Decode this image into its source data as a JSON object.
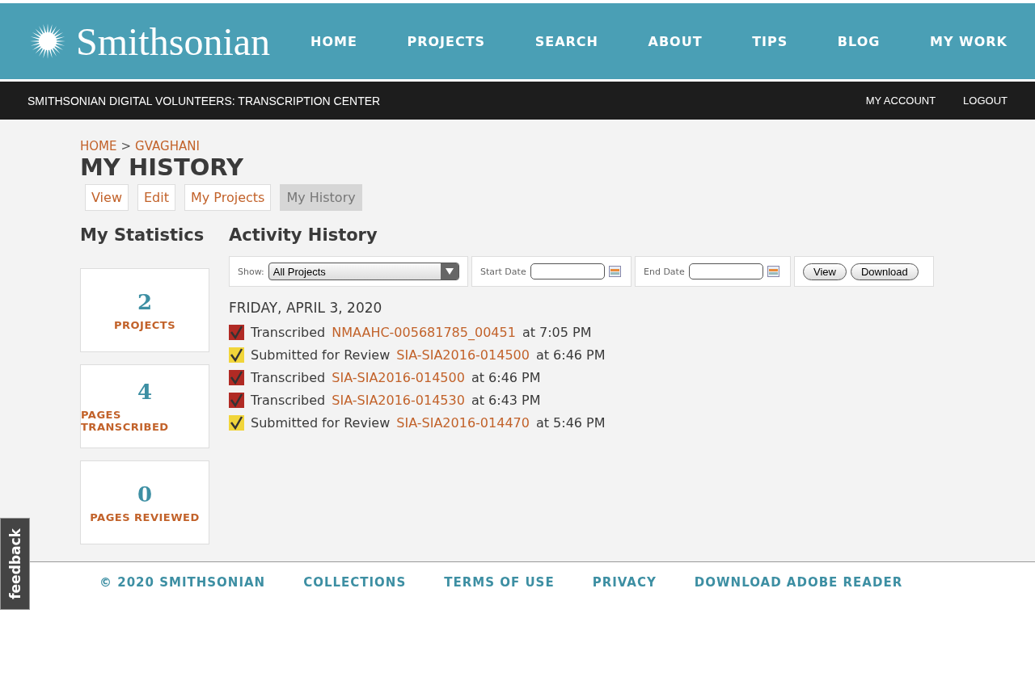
{
  "header": {
    "logo": "Smithsonian",
    "nav": [
      "HOME",
      "PROJECTS",
      "SEARCH",
      "ABOUT",
      "TIPS",
      "BLOG",
      "MY WORK"
    ]
  },
  "subheader": {
    "title": "SMITHSONIAN DIGITAL VOLUNTEERS: TRANSCRIPTION CENTER",
    "links": [
      "MY ACCOUNT",
      "LOGOUT"
    ]
  },
  "breadcrumb": [
    "HOME",
    "GVAGHANI"
  ],
  "breadcrumb_separator": ">",
  "page_title": "MY HISTORY",
  "tabs": [
    {
      "label": "View",
      "selected": false
    },
    {
      "label": "Edit",
      "selected": false
    },
    {
      "label": "My Projects",
      "selected": false
    },
    {
      "label": "My History",
      "selected": true
    }
  ],
  "statistics": {
    "title": "My Statistics",
    "cards": [
      {
        "value": "2",
        "label": "PROJECTS"
      },
      {
        "value": "4",
        "label": "PAGES TRANSCRIBED"
      },
      {
        "value": "0",
        "label": "PAGES REVIEWED"
      }
    ]
  },
  "activity": {
    "title": "Activity History",
    "filter": {
      "show_label": "Show:",
      "show_value": "All Projects",
      "start_label": "Start Date",
      "end_label": "End Date",
      "buttons": [
        "View",
        "Download"
      ]
    },
    "date": "FRIDAY, APRIL 3, 2020",
    "items": [
      {
        "kind": "transcribed",
        "action": "Transcribed",
        "link": "NMAAHC-005681785_00451",
        "time": "at 7:05 PM"
      },
      {
        "kind": "submitted",
        "action": "Submitted for Review",
        "link": "SIA-SIA2016-014500",
        "time": "at 6:46 PM"
      },
      {
        "kind": "transcribed",
        "action": "Transcribed",
        "link": "SIA-SIA2016-014500",
        "time": "at 6:46 PM"
      },
      {
        "kind": "transcribed",
        "action": "Transcribed",
        "link": "SIA-SIA2016-014530",
        "time": "at 6:43 PM"
      },
      {
        "kind": "submitted",
        "action": "Submitted for Review",
        "link": "SIA-SIA2016-014470",
        "time": "at 5:46 PM"
      }
    ]
  },
  "footer": [
    "© 2020 SMITHSONIAN",
    "COLLECTIONS",
    "TERMS OF USE",
    "PRIVACY",
    "DOWNLOAD ADOBE READER"
  ],
  "feedback": "feedback"
}
